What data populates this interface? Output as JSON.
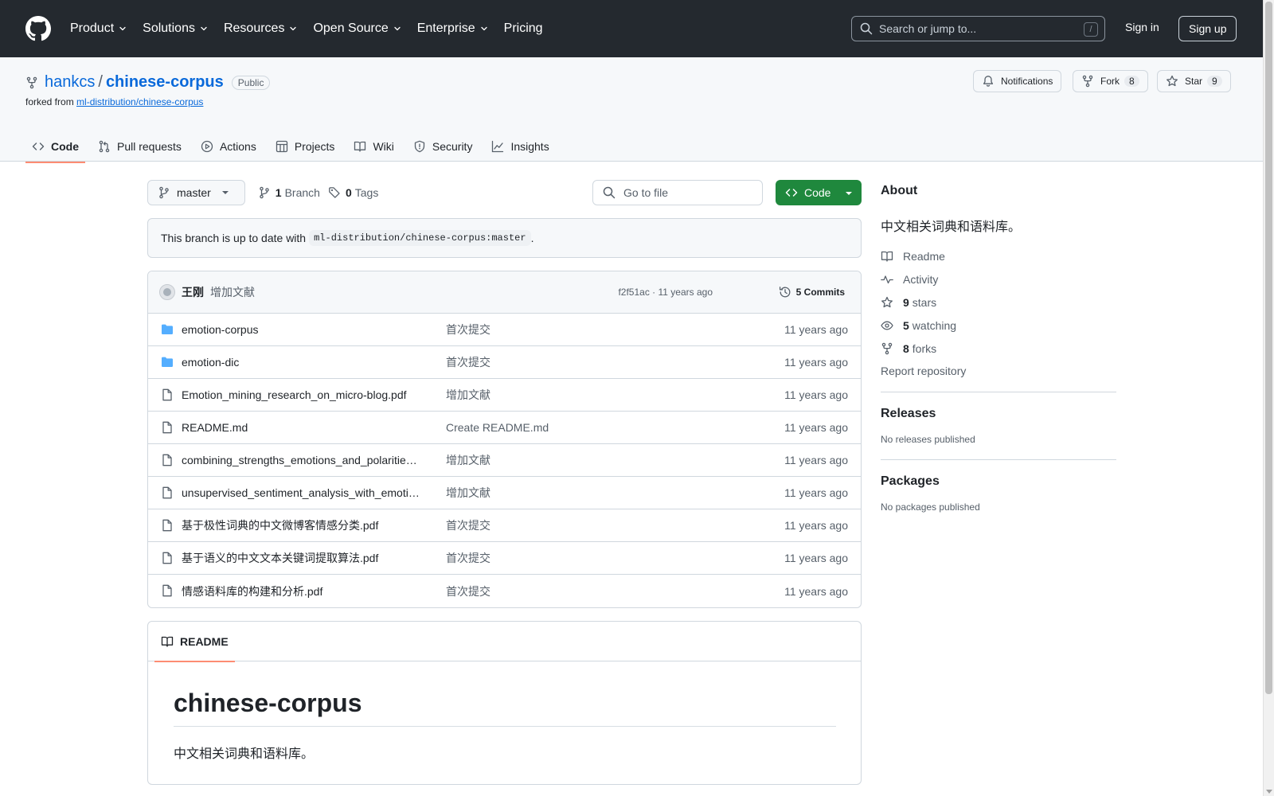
{
  "header": {
    "nav": [
      {
        "label": "Product",
        "has_menu": true
      },
      {
        "label": "Solutions",
        "has_menu": true
      },
      {
        "label": "Resources",
        "has_menu": true
      },
      {
        "label": "Open Source",
        "has_menu": true
      },
      {
        "label": "Enterprise",
        "has_menu": true
      },
      {
        "label": "Pricing",
        "has_menu": false
      }
    ],
    "search_placeholder": "Search or jump to...",
    "search_shortcut": "/",
    "sign_in": "Sign in",
    "sign_up": "Sign up"
  },
  "repo": {
    "owner": "hankcs",
    "separator": "/",
    "name": "chinese-corpus",
    "visibility": "Public",
    "forked_prefix": "forked from",
    "forked_from": "ml-distribution/chinese-corpus",
    "notifications": "Notifications",
    "fork_label": "Fork",
    "fork_count": "8",
    "star_label": "Star",
    "star_count": "9",
    "tabs": [
      {
        "label": "Code",
        "icon": "code-icon",
        "active": true
      },
      {
        "label": "Pull requests",
        "icon": "pull-request-icon",
        "active": false
      },
      {
        "label": "Actions",
        "icon": "play-icon",
        "active": false
      },
      {
        "label": "Projects",
        "icon": "table-icon",
        "active": false
      },
      {
        "label": "Wiki",
        "icon": "book-icon",
        "active": false
      },
      {
        "label": "Security",
        "icon": "shield-icon",
        "active": false
      },
      {
        "label": "Insights",
        "icon": "graph-icon",
        "active": false
      }
    ]
  },
  "toolbar": {
    "branch": "master",
    "branch_count": "1",
    "branch_label": "Branch",
    "tag_count": "0",
    "tag_label": "Tags",
    "goto_placeholder": "Go to file",
    "code_button": "Code"
  },
  "uptodate": {
    "text": "This branch is up to date with",
    "ref": "ml-distribution/chinese-corpus:master",
    "end": "."
  },
  "latest_commit": {
    "author": "王刚",
    "message": "增加文献",
    "meta": "f2f51ac · 11 years ago",
    "commits": "5 Commits"
  },
  "files": [
    {
      "name": "emotion-corpus",
      "type": "folder",
      "message": "首次提交",
      "age": "11 years ago"
    },
    {
      "name": "emotion-dic",
      "type": "folder",
      "message": "首次提交",
      "age": "11 years ago"
    },
    {
      "name": "Emotion_mining_research_on_micro-blog.pdf",
      "type": "file",
      "message": "增加文献",
      "age": "11 years ago"
    },
    {
      "name": "README.md",
      "type": "file",
      "message": "Create README.md",
      "age": "11 years ago"
    },
    {
      "name": "combining_strengths_emotions_and_polarities_for_boosting_twitter_sentiment_analysis.pdf",
      "type": "file",
      "message": "增加文献",
      "age": "11 years ago"
    },
    {
      "name": "unsupervised_sentiment_analysis_with_emotional_signals.pdf",
      "type": "file",
      "message": "增加文献",
      "age": "11 years ago"
    },
    {
      "name": "基于极性词典的中文微博客情感分类.pdf",
      "type": "file",
      "message": "首次提交",
      "age": "11 years ago"
    },
    {
      "name": "基于语义的中文文本关键词提取算法.pdf",
      "type": "file",
      "message": "首次提交",
      "age": "11 years ago"
    },
    {
      "name": "情感语料库的构建和分析.pdf",
      "type": "file",
      "message": "首次提交",
      "age": "11 years ago"
    }
  ],
  "readme": {
    "tab": "README",
    "title": "chinese-corpus",
    "description": "中文相关词典和语料库。"
  },
  "about": {
    "heading": "About",
    "description": "中文相关词典和语料库。",
    "readme": "Readme",
    "activity": "Activity",
    "stars_count": "9",
    "stars_label": "stars",
    "watching_count": "5",
    "watching_label": "watching",
    "forks_count": "8",
    "forks_label": "forks",
    "report": "Report repository"
  },
  "releases": {
    "heading": "Releases",
    "empty": "No releases published"
  },
  "packages": {
    "heading": "Packages",
    "empty": "No packages published"
  },
  "colors": {
    "header_bg": "#24292f",
    "link": "#0969da",
    "primary_button": "#1f883d",
    "tab_underline": "#fd8c73",
    "folder": "#54aeff"
  }
}
